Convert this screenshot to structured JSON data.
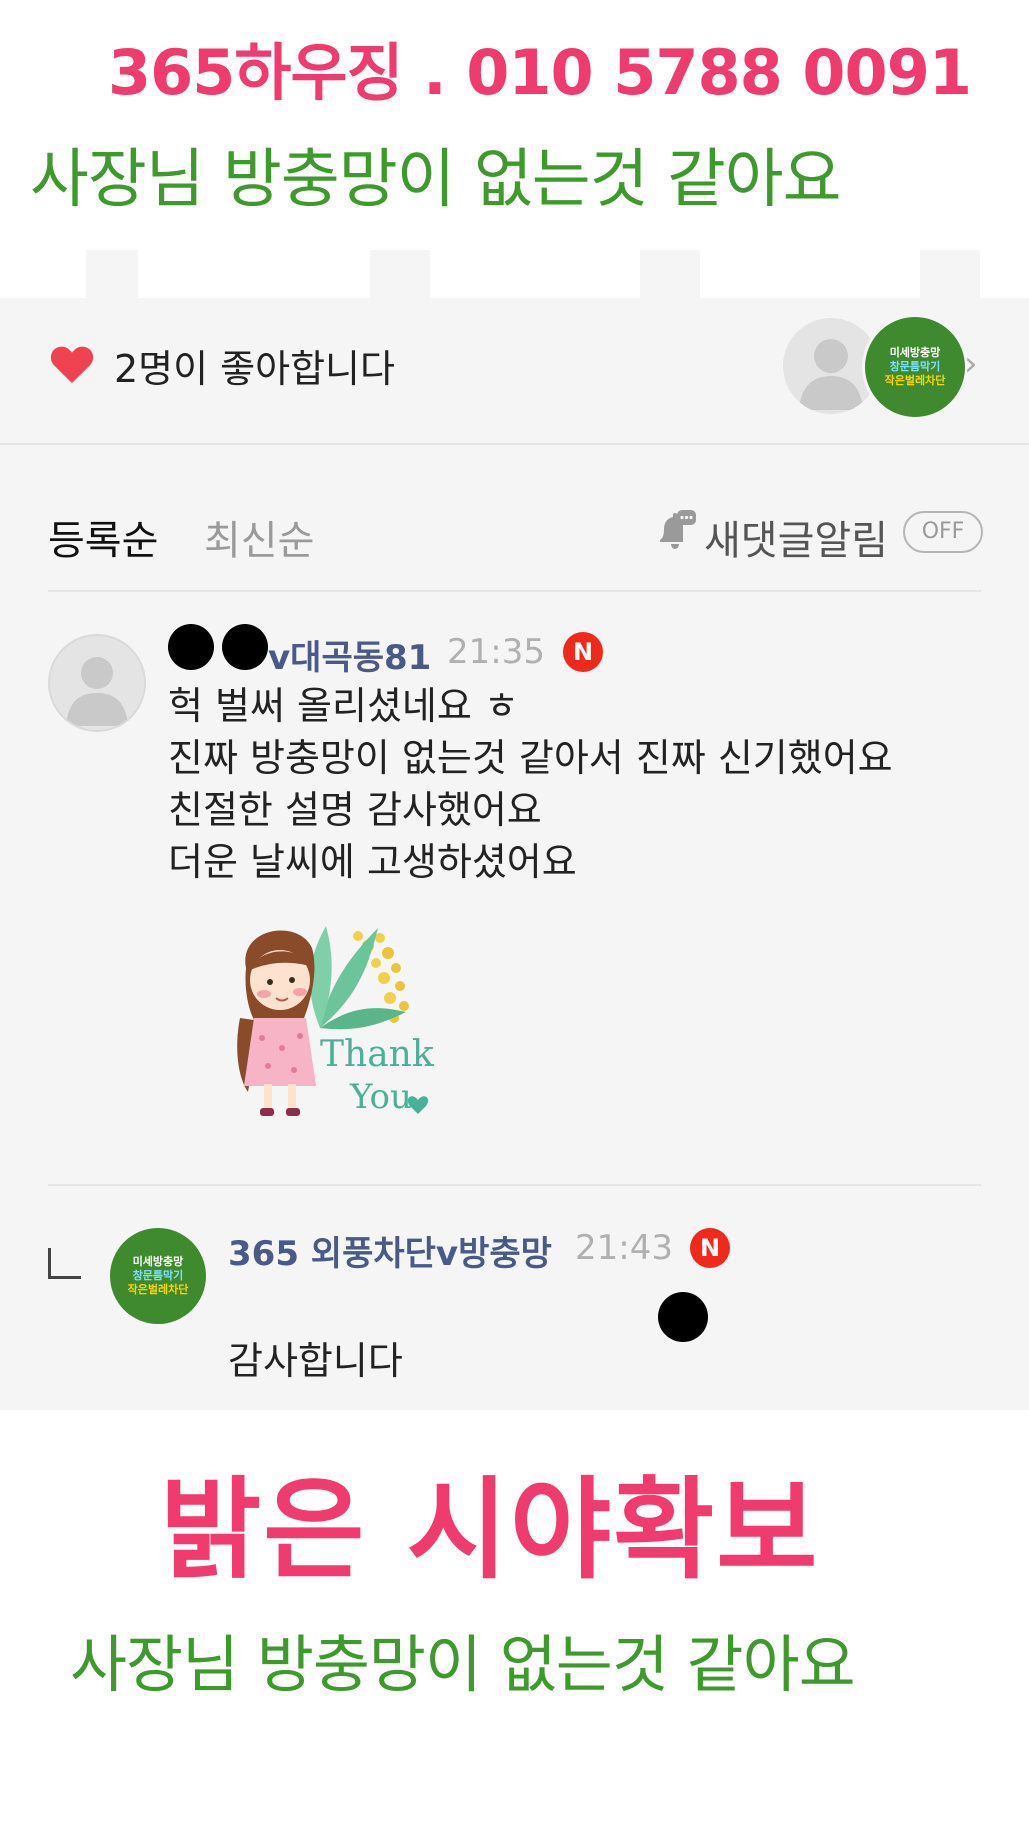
{
  "promo": {
    "top_line": "365하우징 . 010 5788 0091",
    "subtitle_top": "사장님 방충망이 없는것 같아요",
    "headline_bottom": "밝은 시야확보",
    "subtitle_bottom": "사장님 방충망이 없는것 같아요"
  },
  "likes": {
    "text": "2명이 좋아합니다",
    "avatar_badge_lines": [
      "미세방충망",
      "창문틈막기",
      "작은벌레차단"
    ]
  },
  "comments_header": {
    "sort_options": [
      "등록순",
      "최신순"
    ],
    "notification_label": "새댓글알림",
    "toggle_label": "OFF"
  },
  "comments": [
    {
      "author": "v대곡동81",
      "time": "21:35",
      "badge": "N",
      "lines": [
        "헉 벌써 올리셨네요 ㅎ",
        "진짜 방충망이 없는것 같아서 진짜 신기했어요",
        "친절한 설명 감사했어요",
        "더운 날씨에 고생하셨어요"
      ],
      "sticker_text": [
        "Thank",
        "You"
      ]
    },
    {
      "author": "365 외풍차단v방충망",
      "time": "21:43",
      "badge": "N",
      "text": "감사합니다",
      "avatar_badge_lines": [
        "미세방충망",
        "창문틈막기",
        "작은벌레차단"
      ]
    }
  ],
  "colors": {
    "pink": "#ef3b6e",
    "green": "#3e9a2d",
    "username": "#4a5a86",
    "new_badge": "#ef2a1a",
    "panel_bg": "#f5f5f5"
  }
}
